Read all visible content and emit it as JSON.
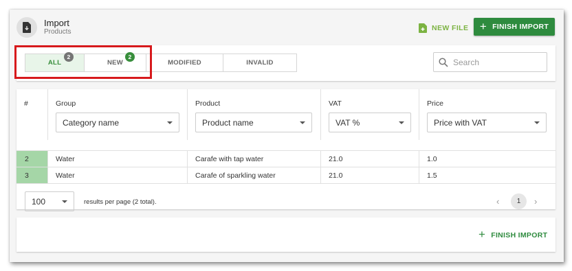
{
  "header": {
    "title": "Import",
    "subtitle": "Products",
    "icon": "import-file-icon",
    "new_file_label": "NEW FILE",
    "finish_import_label": "FINISH IMPORT"
  },
  "tabs": [
    {
      "label": "ALL",
      "badge": "2",
      "active": true
    },
    {
      "label": "NEW",
      "badge": "2",
      "active": false
    },
    {
      "label": "MODIFIED",
      "badge": null,
      "active": false
    },
    {
      "label": "INVALID",
      "badge": null,
      "active": false
    }
  ],
  "search": {
    "placeholder": "Search",
    "value": ""
  },
  "table": {
    "columns": [
      {
        "label": "#",
        "filter": null
      },
      {
        "label": "Group",
        "filter": "Category name"
      },
      {
        "label": "Product",
        "filter": "Product name"
      },
      {
        "label": "VAT",
        "filter": "VAT %"
      },
      {
        "label": "Price",
        "filter": "Price with VAT"
      }
    ],
    "rows": [
      [
        "2",
        "Water",
        "Carafe with tap water",
        "21.0",
        "1.0"
      ],
      [
        "3",
        "Water",
        "Carafe of sparkling water",
        "21.0",
        "1.5"
      ]
    ]
  },
  "pagination": {
    "per_page": "100",
    "summary": "results per page (2 total).",
    "current_page": "1",
    "prev_icon": "chevron-left-icon",
    "next_icon": "chevron-right-icon"
  },
  "footer": {
    "finish_import_label": "FINISH IMPORT"
  },
  "colors": {
    "accent_green": "#2e8b3e",
    "light_green": "#7cb342",
    "row_number_bg": "#a5d6a7",
    "active_tab_bg": "#e8f5e9",
    "highlight_box": "#d7191c"
  }
}
